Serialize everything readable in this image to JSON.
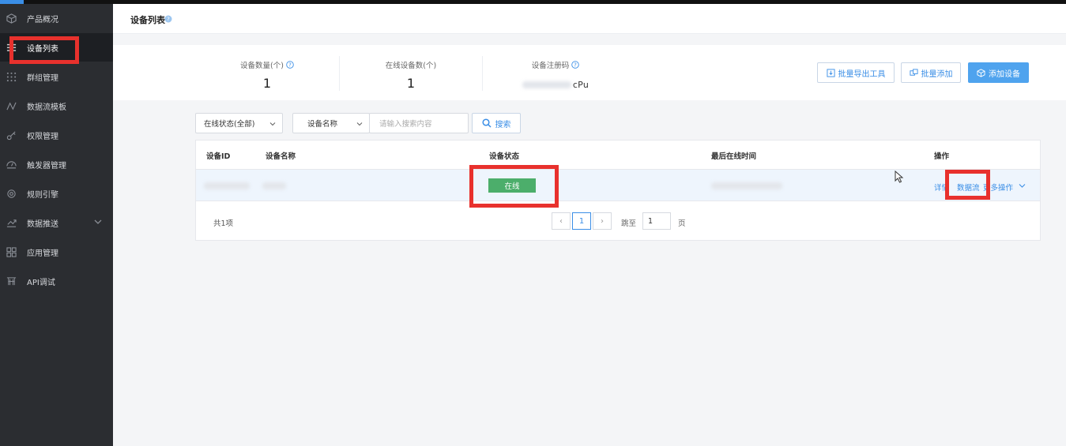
{
  "sidebar": {
    "items": [
      {
        "label": "产品概况",
        "icon": "cube-icon"
      },
      {
        "label": "设备列表",
        "icon": "list-icon",
        "active": true
      },
      {
        "label": "群组管理",
        "icon": "grid-dots-icon"
      },
      {
        "label": "数据流模板",
        "icon": "wave-icon"
      },
      {
        "label": "权限管理",
        "icon": "key-icon"
      },
      {
        "label": "触发器管理",
        "icon": "trigger-icon"
      },
      {
        "label": "规则引擎",
        "icon": "gear-ring-icon"
      },
      {
        "label": "数据推送",
        "icon": "push-icon",
        "expandable": true
      },
      {
        "label": "应用管理",
        "icon": "apps-icon"
      },
      {
        "label": "API调试",
        "icon": "api-icon"
      }
    ]
  },
  "header": {
    "title": "设备列表"
  },
  "stats": {
    "device_count_label": "设备数量(个)",
    "device_count": "1",
    "online_count_label": "在线设备数(个)",
    "online_count": "1",
    "reg_code_label": "设备注册码",
    "reg_code": "cPu"
  },
  "actions": {
    "export_tool": "批量导出工具",
    "batch_add": "批量添加",
    "add_device": "添加设备"
  },
  "filters": {
    "status": "在线状态(全部)",
    "field": "设备名称",
    "search_placeholder": "请输入搜索内容",
    "search_button": "搜索"
  },
  "table": {
    "columns": [
      "设备ID",
      "设备名称",
      "设备状态",
      "最后在线时间",
      "操作"
    ],
    "rows": [
      {
        "status": "在线",
        "ops": [
          "详情",
          "数据流",
          "更多操作"
        ]
      }
    ],
    "total": "共1项"
  },
  "pagination": {
    "prev": "‹",
    "current": "1",
    "next": "›",
    "goto_label": "跳至",
    "goto_value": "1",
    "page_suffix": "页"
  },
  "colors": {
    "sidebar_bg": "#2b2d31",
    "accent": "#3a8ee6",
    "primary_button": "#4fa3ee",
    "online_badge": "#4cae6b",
    "highlight": "#e8312d"
  }
}
